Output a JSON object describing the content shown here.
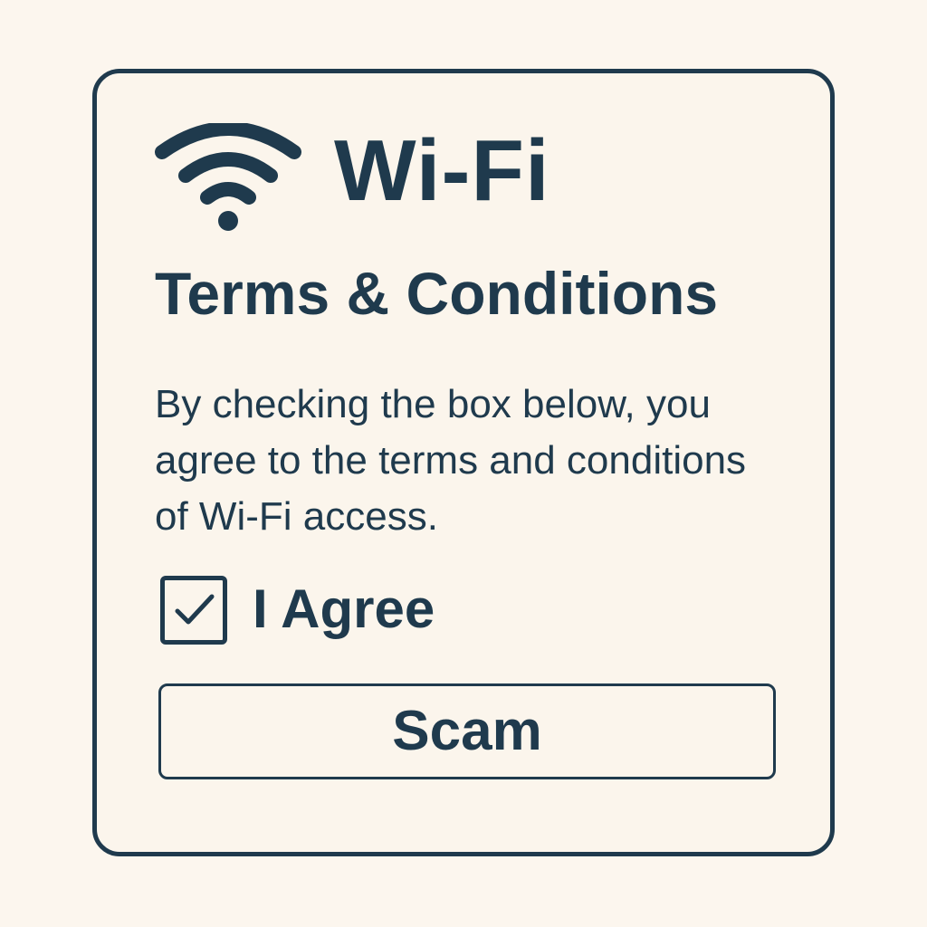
{
  "colors": {
    "background": "#fcf6ee",
    "card_background": "#fbf5ec",
    "primary": "#1f3a4d"
  },
  "header": {
    "icon": "wifi-icon",
    "title": "Wi-Fi"
  },
  "terms": {
    "heading": "Terms & Conditions",
    "body": "By checking the box below, you agree to the terms and conditions of Wi-Fi access."
  },
  "agreement": {
    "checked": true,
    "icon": "checkmark-icon",
    "label": "I Agree"
  },
  "action": {
    "button_label": "Scam"
  }
}
